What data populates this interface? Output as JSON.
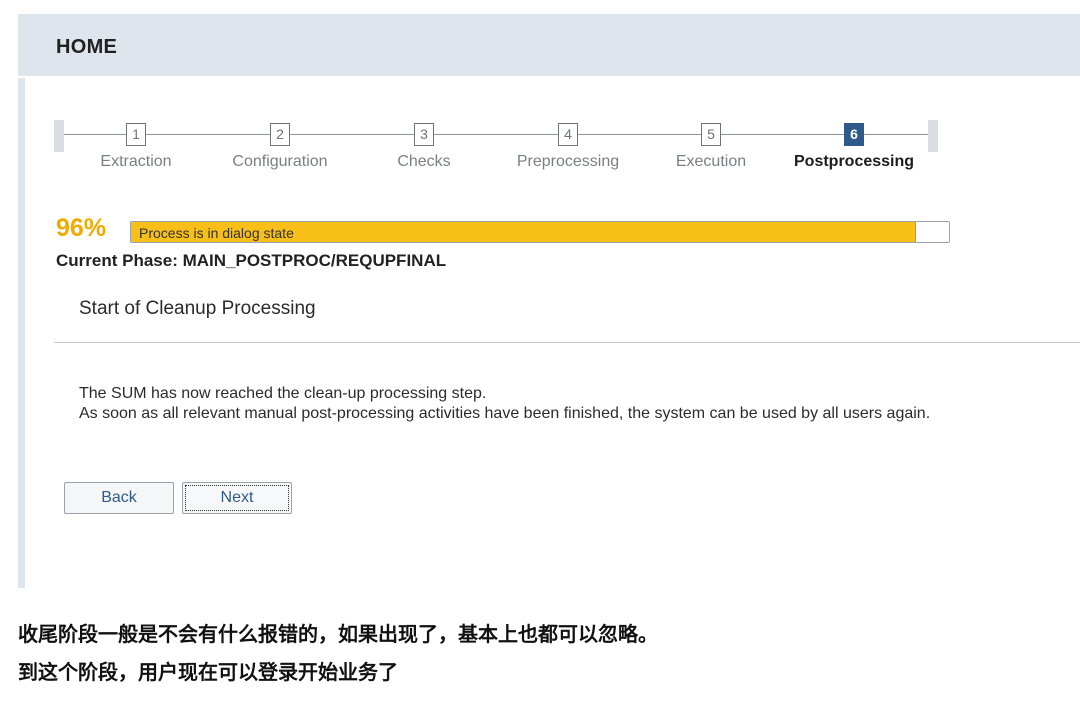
{
  "header": {
    "title": "HOME"
  },
  "stepper": {
    "steps": [
      {
        "number": "1",
        "label": "Extraction"
      },
      {
        "number": "2",
        "label": "Configuration"
      },
      {
        "number": "3",
        "label": "Checks"
      },
      {
        "number": "4",
        "label": "Preprocessing"
      },
      {
        "number": "5",
        "label": "Execution"
      },
      {
        "number": "6",
        "label": "Postprocessing"
      }
    ],
    "active_step": 6
  },
  "progress": {
    "percent_label": "96%",
    "value": 96,
    "status_text": "Process is in dialog state"
  },
  "phase": {
    "current": "Current Phase: MAIN_POSTPROC/REQUPFINAL",
    "heading": "Start of Cleanup Processing"
  },
  "info": {
    "line1": "The SUM has now reached the clean-up processing step.",
    "line2": "As soon as all relevant manual post-processing activities have been finished, the system can be used by all users again."
  },
  "buttons": {
    "back": "Back",
    "next": "Next"
  },
  "caption": {
    "line1": "收尾阶段一般是不会有什么报错的，如果出现了，基本上也都可以忽略。",
    "line2": "到这个阶段，用户现在可以登录开始业务了"
  },
  "colors": {
    "header_bg": "#dfe5ec",
    "progress_fill": "#f7bf17",
    "percent_text": "#f0ab00",
    "active_step": "#2e5a8a"
  }
}
